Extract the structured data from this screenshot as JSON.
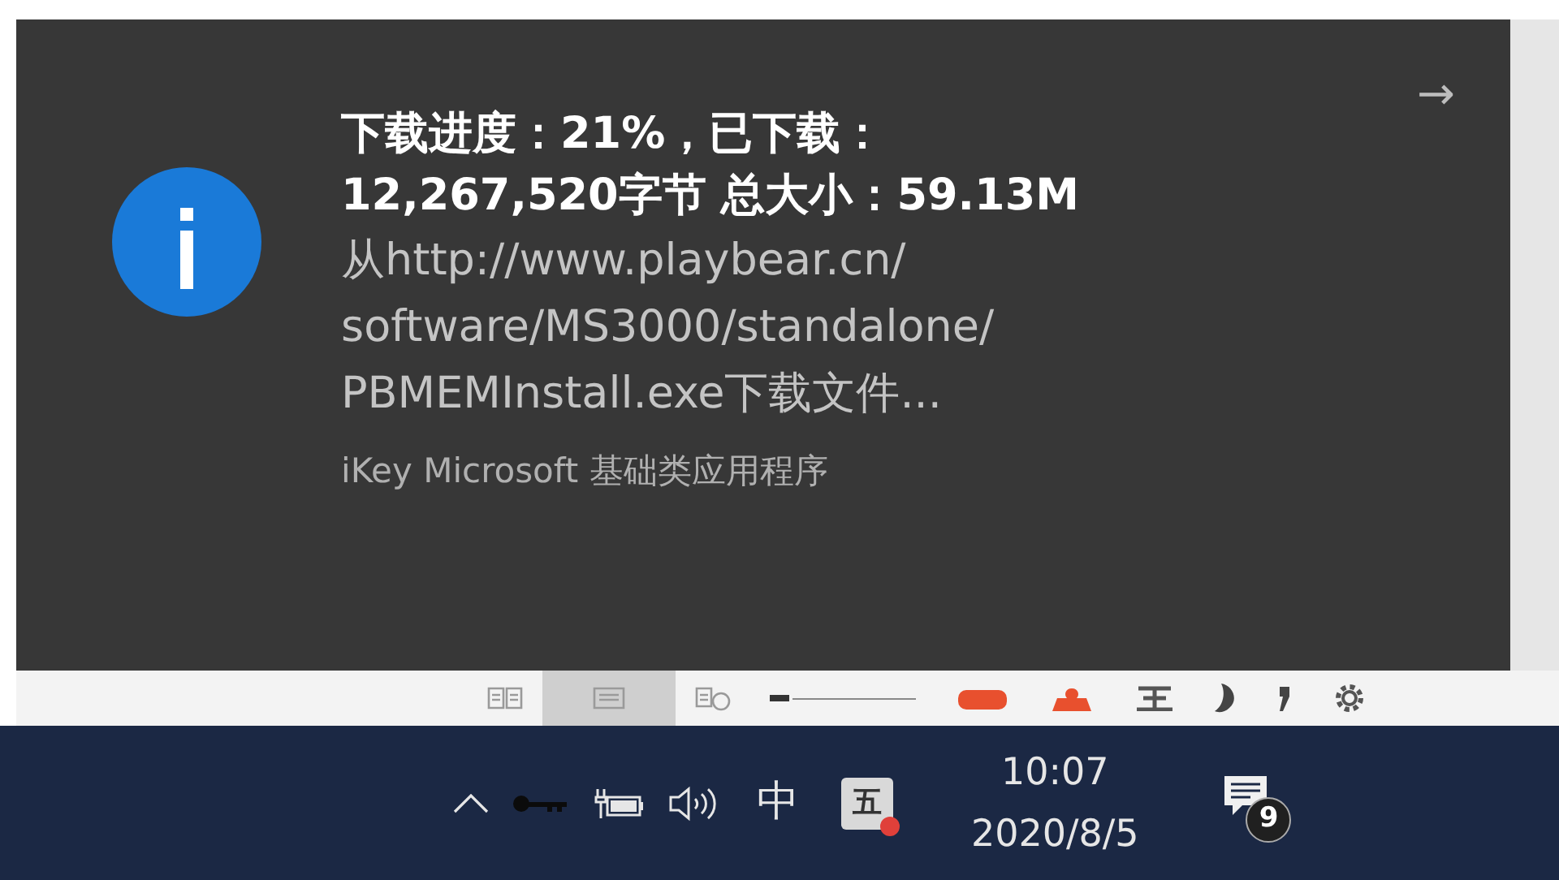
{
  "toast": {
    "title": [
      "下载进度：21%，已下载：",
      "12,267,520字节  总大小：59.13M"
    ],
    "body": [
      "从http://www.playbear.cn/",
      "software/MS3000/standalone/",
      "PBMEMInstall.exe下载文件..."
    ],
    "attribution": "iKey Microsoft 基础类应用程序",
    "arrow": "→"
  },
  "toolbar": {
    "items": [
      {
        "kind": "book",
        "selected": false
      },
      {
        "kind": "list",
        "selected": true
      },
      {
        "kind": "globe",
        "selected": false
      },
      {
        "kind": "dash",
        "selected": false
      },
      {
        "kind": "red-shape",
        "selected": false
      },
      {
        "kind": "red-person",
        "selected": false
      },
      {
        "kind": "glyph",
        "selected": false
      },
      {
        "kind": "moon",
        "selected": false
      },
      {
        "kind": "comma",
        "selected": false
      },
      {
        "kind": "gear",
        "selected": false
      }
    ]
  },
  "taskbar": {
    "tray": [
      {
        "kind": "chevron"
      },
      {
        "kind": "key"
      },
      {
        "kind": "battery"
      },
      {
        "kind": "volume"
      }
    ],
    "language": "中",
    "ime": "五",
    "time": "10:07",
    "date": "2020/8/5",
    "notification_count": "9"
  }
}
